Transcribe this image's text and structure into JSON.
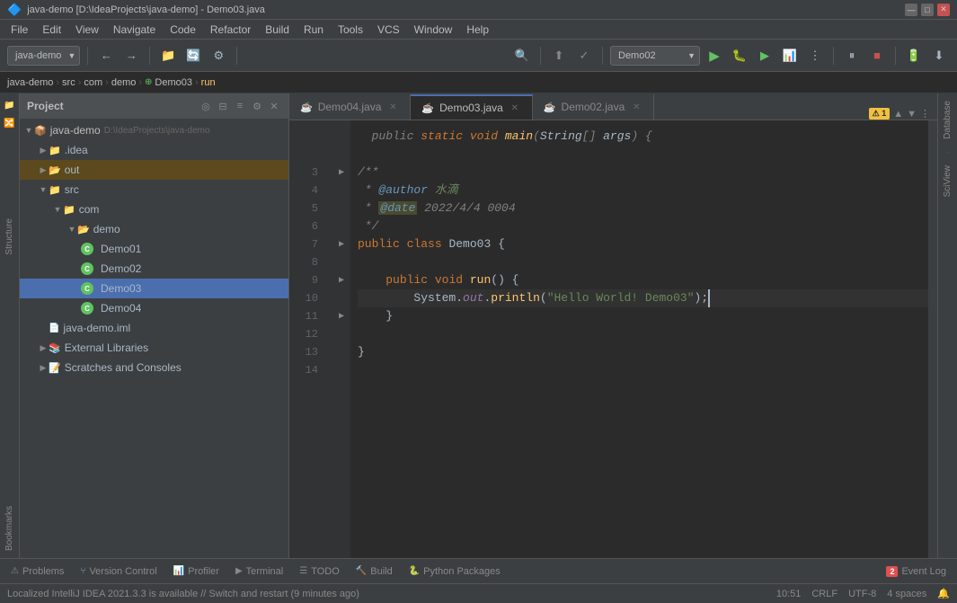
{
  "titlebar": {
    "title": "java-demo [D:\\IdeaProjects\\java-demo] - Demo03.java",
    "controls": [
      "—",
      "□",
      "✕"
    ]
  },
  "menubar": {
    "items": [
      "File",
      "Edit",
      "View",
      "Navigate",
      "Code",
      "Refactor",
      "Build",
      "Run",
      "Tools",
      "VCS",
      "Window",
      "Help"
    ]
  },
  "toolbar": {
    "project_name": "java-demo",
    "run_config": "Demo02",
    "breadcrumb": {
      "parts": [
        "java-demo",
        "src",
        "com",
        "demo",
        "Demo03",
        "run"
      ]
    }
  },
  "project": {
    "title": "Project",
    "root": {
      "name": "java-demo",
      "path": "D:\\IdeaProjects\\java-demo",
      "children": [
        {
          "name": ".idea",
          "type": "folder",
          "indent": 1
        },
        {
          "name": "out",
          "type": "folder-yellow",
          "indent": 1,
          "selected": true
        },
        {
          "name": "src",
          "type": "folder",
          "indent": 1,
          "children": [
            {
              "name": "com",
              "type": "folder",
              "indent": 2,
              "children": [
                {
                  "name": "demo",
                  "type": "folder-yellow",
                  "indent": 3,
                  "children": [
                    {
                      "name": "Demo01",
                      "type": "java-c",
                      "indent": 4
                    },
                    {
                      "name": "Demo02",
                      "type": "java-c",
                      "indent": 4
                    },
                    {
                      "name": "Demo03",
                      "type": "java-c",
                      "indent": 4
                    },
                    {
                      "name": "Demo04",
                      "type": "java-c",
                      "indent": 4
                    }
                  ]
                }
              ]
            }
          ]
        },
        {
          "name": "java-demo.iml",
          "type": "iml",
          "indent": 1
        },
        {
          "name": "External Libraries",
          "type": "lib",
          "indent": 1
        },
        {
          "name": "Scratches and Consoles",
          "type": "scratches",
          "indent": 1
        }
      ]
    }
  },
  "tabs": [
    {
      "name": "Demo04.java",
      "active": false,
      "icon": "java"
    },
    {
      "name": "Demo03.java",
      "active": true,
      "icon": "java"
    },
    {
      "name": "Demo02.java",
      "active": false,
      "icon": "java"
    }
  ],
  "editor": {
    "warning_count": "1",
    "lines": [
      {
        "num": 3,
        "content": "/**",
        "type": "comment"
      },
      {
        "num": 4,
        "content": " * @author 水滴",
        "type": "comment-author"
      },
      {
        "num": 5,
        "content": " * @date 2022/4/4 0004",
        "type": "comment-date"
      },
      {
        "num": 6,
        "content": " */",
        "type": "comment"
      },
      {
        "num": 7,
        "content": "public class Demo03 {",
        "type": "class"
      },
      {
        "num": 8,
        "content": "",
        "type": "empty"
      },
      {
        "num": 9,
        "content": "    public void run() {",
        "type": "method"
      },
      {
        "num": 10,
        "content": "        System.out.println(\"Hello World! Demo03\");",
        "type": "code-cursor"
      },
      {
        "num": 11,
        "content": "    }",
        "type": "code"
      },
      {
        "num": 12,
        "content": "",
        "type": "empty"
      },
      {
        "num": 13,
        "content": "}",
        "type": "code"
      },
      {
        "num": 14,
        "content": "",
        "type": "empty"
      }
    ]
  },
  "bottom_tabs": [
    {
      "name": "Problems",
      "icon": "⚠"
    },
    {
      "name": "Version Control",
      "icon": "🔀"
    },
    {
      "name": "Profiler",
      "icon": "📊"
    },
    {
      "name": "Terminal",
      "icon": "▶"
    },
    {
      "name": "TODO",
      "icon": "☑"
    },
    {
      "name": "Build",
      "icon": "🔨"
    },
    {
      "name": "Python Packages",
      "icon": "🐍"
    }
  ],
  "event_log": {
    "label": "Event Log",
    "badge": "2"
  },
  "statusbar": {
    "message": "Localized IntelliJ IDEA 2021.3.3 is available // Switch and restart (9 minutes ago)",
    "time": "10:51",
    "line_ending": "CRLF",
    "encoding": "UTF-8",
    "indent": "4 spaces",
    "notifications": "🔔"
  },
  "right_sidebar": {
    "panels": [
      "Database",
      "SciView"
    ]
  },
  "left_sidebar": {
    "panels": [
      "Structure",
      "Bookmarks"
    ]
  }
}
